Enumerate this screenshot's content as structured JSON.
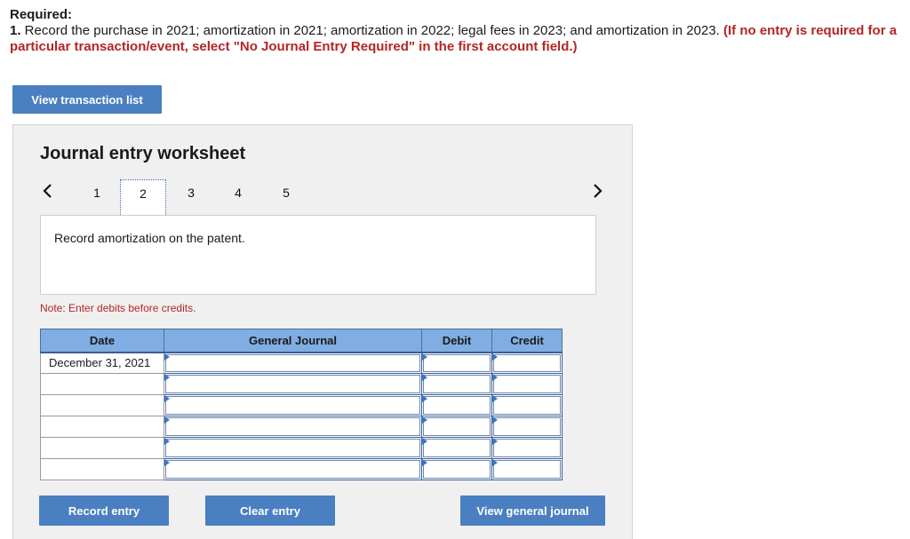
{
  "instructions": {
    "title": "Required:",
    "number": "1.",
    "text": " Record the purchase in 2021; amortization in 2021; amortization in 2022; legal fees in 2023; and amortization in 2023. ",
    "note": "(If no entry is required for a particular transaction/event, select \"No Journal Entry Required\" in the first account field.)"
  },
  "buttons": {
    "view_transaction_list": "View transaction list",
    "record_entry": "Record entry",
    "clear_entry": "Clear entry",
    "view_general_journal": "View general journal"
  },
  "worksheet": {
    "title": "Journal entry worksheet",
    "pages": [
      "1",
      "2",
      "3",
      "4",
      "5"
    ],
    "active_page": "2",
    "description": "Record amortization on the patent.",
    "note": "Note: Enter debits before credits."
  },
  "table": {
    "headers": [
      "Date",
      "General Journal",
      "Debit",
      "Credit"
    ],
    "rows": [
      {
        "date": "December 31, 2021"
      },
      {
        "date": ""
      },
      {
        "date": ""
      },
      {
        "date": ""
      },
      {
        "date": ""
      },
      {
        "date": ""
      }
    ]
  },
  "colors": {
    "accent": "#4a7fc1",
    "header_bg": "#80aee2",
    "warning": "#b52525"
  }
}
